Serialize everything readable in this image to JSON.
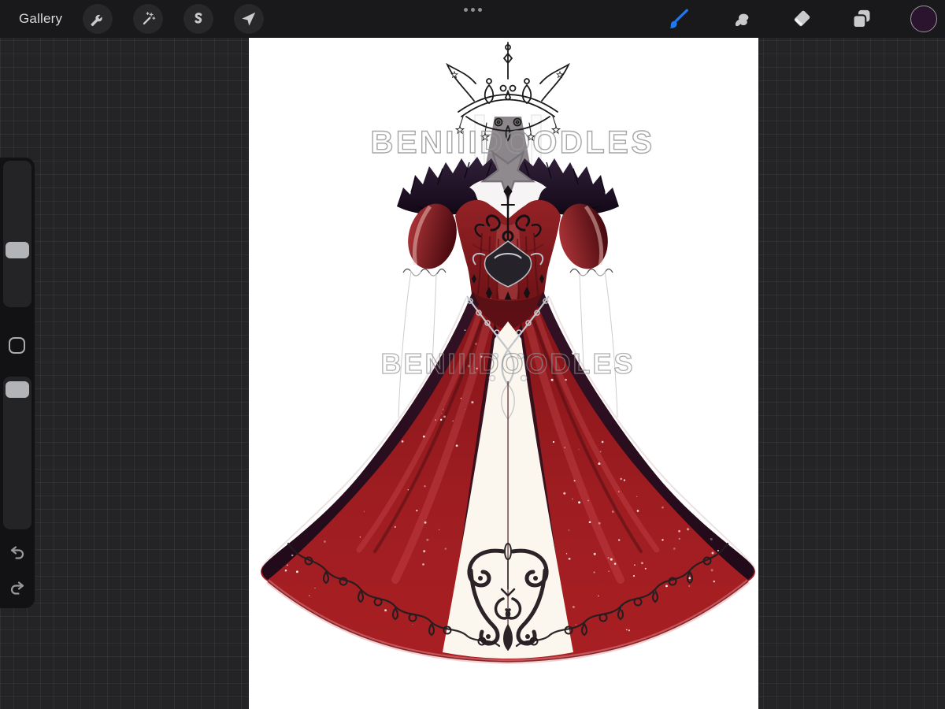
{
  "toolbar": {
    "gallery_label": "Gallery",
    "menu_label": "Canvas menu",
    "left_tools": [
      {
        "id": "actions",
        "label": "Actions"
      },
      {
        "id": "adjustments",
        "label": "Adjustments"
      },
      {
        "id": "selection",
        "label": "Selection"
      },
      {
        "id": "transform",
        "label": "Transform"
      }
    ],
    "right_tools": [
      {
        "id": "paint",
        "label": "Paint",
        "active": true
      },
      {
        "id": "smudge",
        "label": "Smudge",
        "active": false
      },
      {
        "id": "erase",
        "label": "Erase",
        "active": false
      },
      {
        "id": "layers",
        "label": "Layers",
        "active": false
      },
      {
        "id": "color",
        "label": "Color",
        "active": false
      }
    ],
    "active_tool_color": "#2079f2",
    "icon_color": "#c9cacc",
    "current_color_swatch": "#2a142e"
  },
  "sidebar": {
    "brush_size_slider": {
      "thumb_fraction_from_top": 0.63
    },
    "opacity_slider": {
      "thumb_fraction_from_top": 0.02
    },
    "modify_label": "Modify",
    "undo_label": "Undo",
    "redo_label": "Redo"
  },
  "canvas": {
    "watermark_text": "BENIIIDOODLES",
    "background_color": "#ffffff",
    "artwork_subject": "red ballgown with crown"
  }
}
